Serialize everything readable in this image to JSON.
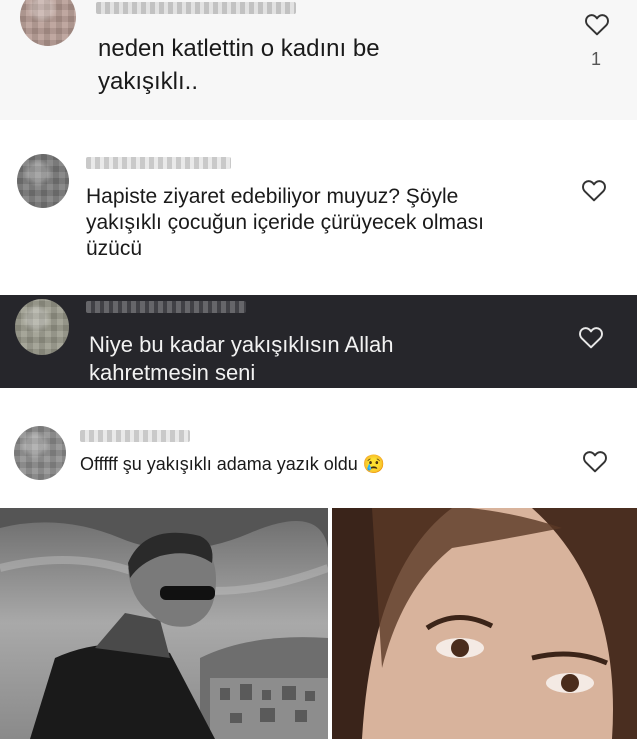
{
  "comments": [
    {
      "text": "neden katlettin o kadını be\nyakışıklı..",
      "likes": "1"
    },
    {
      "text": "Hapiste ziyaret edebiliyor muyuz? Şöyle\nyakışıklı çocuğun içeride çürüyecek olması\nüzücü"
    },
    {
      "text": "Niye bu kadar yakışıklısın Allah\nkahretmesin seni"
    },
    {
      "text": "Offfff şu yakışıklı adama yazık oldu",
      "emoji": "😢"
    }
  ],
  "icons": {
    "like": "heart-outline-icon"
  },
  "colors": {
    "dark_panel": "#26262b",
    "light_panel": "#ffffff",
    "first_panel": "#f7f7f7",
    "text_dark": "#1a1a1a",
    "text_light": "#f2f2f2"
  }
}
